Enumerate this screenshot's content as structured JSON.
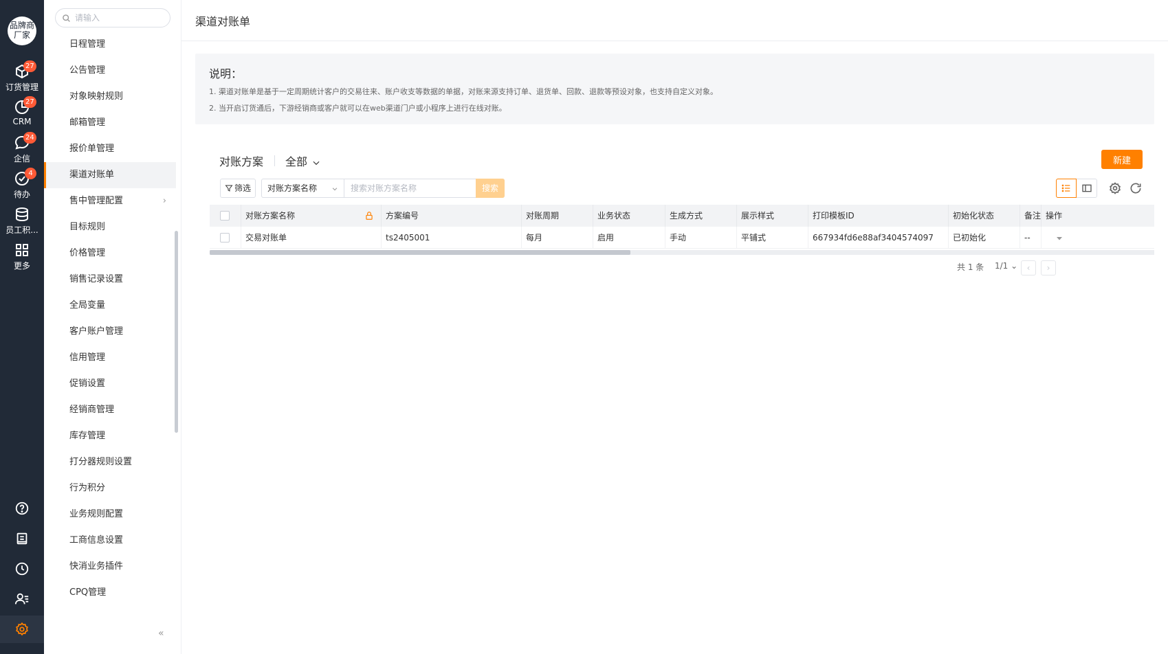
{
  "rail": {
    "brand_line1": "品牌商",
    "brand_line2": "厂家",
    "items": [
      {
        "label": "订货管理",
        "badge": "27",
        "icon": "cube-icon"
      },
      {
        "label": "CRM",
        "badge": "27",
        "icon": "pie-chart-icon"
      },
      {
        "label": "企信",
        "badge": "24",
        "icon": "chat-bubble-icon"
      },
      {
        "label": "待办",
        "badge": "4",
        "icon": "check-circle-icon"
      },
      {
        "label": "员工积...",
        "icon": "database-icon"
      },
      {
        "label": "更多",
        "icon": "grid-icon"
      }
    ],
    "bottom_icons": [
      "help-icon",
      "notebook-icon",
      "clock-icon",
      "user-list-icon",
      "settings-icon"
    ],
    "accent": "#ff8000"
  },
  "menu": {
    "search_placeholder": "请输入",
    "items": [
      {
        "label": "日程管理"
      },
      {
        "label": "公告管理"
      },
      {
        "label": "对象映射规则"
      },
      {
        "label": "邮箱管理"
      },
      {
        "label": "报价单管理"
      },
      {
        "label": "渠道对账单",
        "active": true
      },
      {
        "label": "售中管理配置",
        "has_children": true
      },
      {
        "label": "目标规则"
      },
      {
        "label": "价格管理"
      },
      {
        "label": "销售记录设置"
      },
      {
        "label": "全局变量"
      },
      {
        "label": "客户账户管理"
      },
      {
        "label": "信用管理"
      },
      {
        "label": "促销设置"
      },
      {
        "label": "经销商管理"
      },
      {
        "label": "库存管理"
      },
      {
        "label": "打分器规则设置"
      },
      {
        "label": "行为积分"
      },
      {
        "label": "业务规则配置"
      },
      {
        "label": "工商信息设置"
      },
      {
        "label": "快消业务插件"
      },
      {
        "label": "CPQ管理"
      }
    ],
    "collapse_glyph": "«"
  },
  "main": {
    "title": "渠道对账单",
    "note": {
      "title": "说明：",
      "lines": [
        "1. 渠道对账单是基于一定周期统计客户的交易往来、账户收支等数据的单据，对账来源支持订单、退货单、回款、退款等预设对象，也支持自定义对象。",
        "2. 当开启订货通后，下游经销商或客户就可以在web渠道门户或小程序上进行在线对账。"
      ]
    },
    "scheme_title": "对账方案",
    "scheme_filter": "全部",
    "new_button": "新建",
    "filter_button": "筛选",
    "search_field": "对账方案名称",
    "search_placeholder": "搜索对账方案名称",
    "search_button": "搜索",
    "table": {
      "columns": [
        "对账方案名称",
        "方案编号",
        "对账周期",
        "业务状态",
        "生成方式",
        "展示样式",
        "打印模板ID",
        "初始化状态",
        "备注",
        "操作"
      ],
      "rows": [
        [
          "交易对账单",
          "ts2405001",
          "每月",
          "启用",
          "手动",
          "平铺式",
          "667934fd6e88af3404574097",
          "已初始化",
          "--",
          ""
        ]
      ]
    },
    "pager": {
      "total": "共 1 条",
      "page": "1/1"
    }
  }
}
